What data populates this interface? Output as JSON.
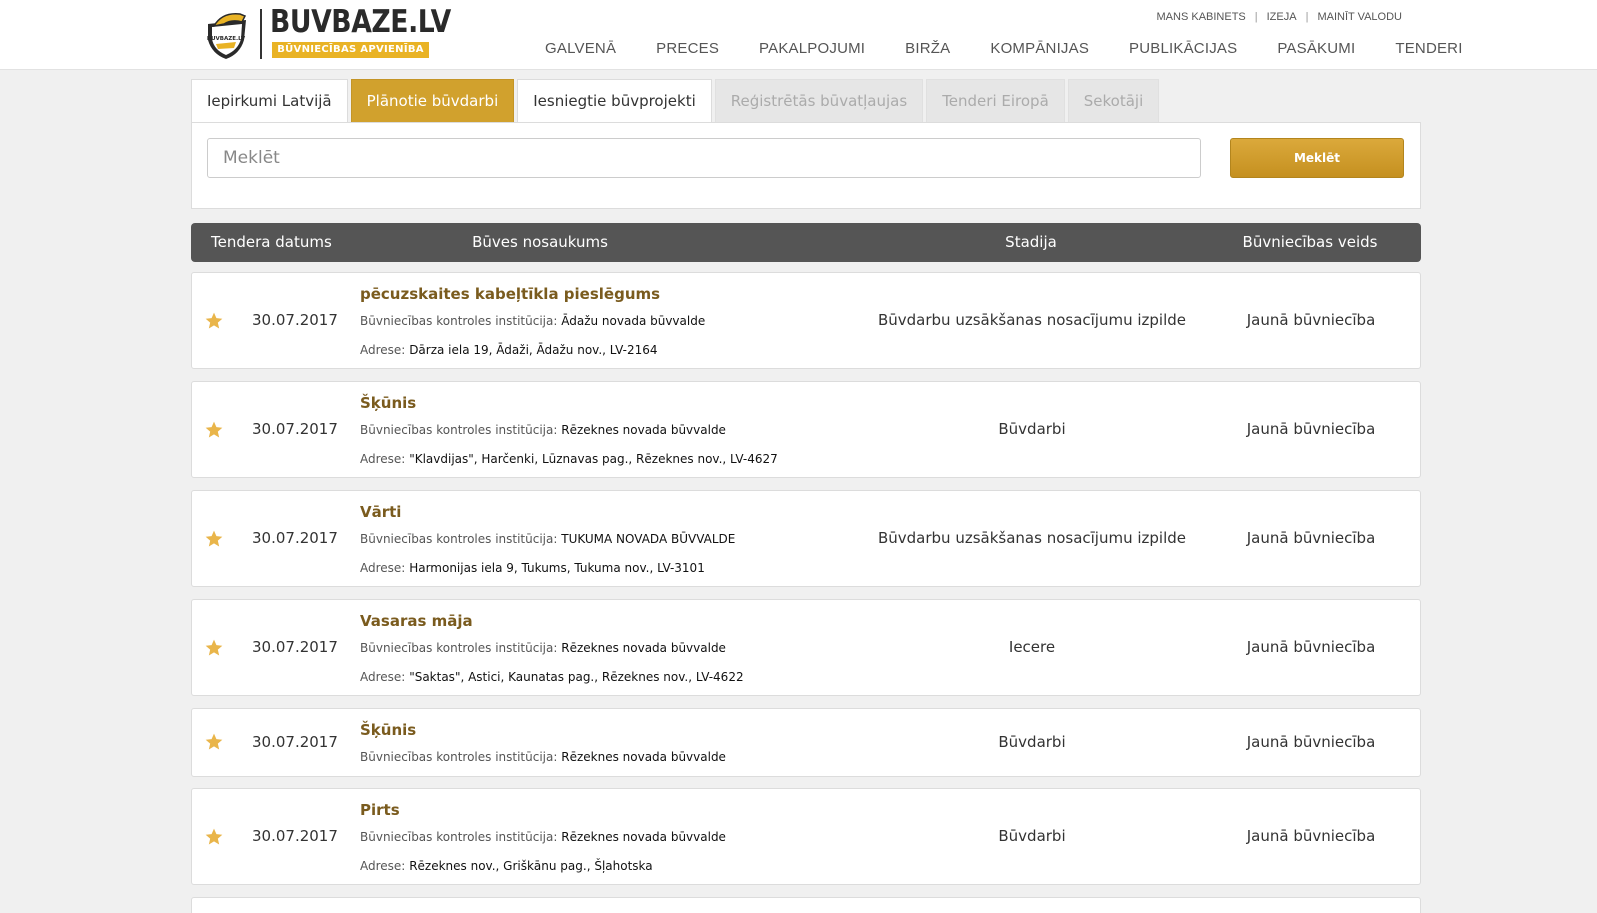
{
  "brand": {
    "name": "BUVBAZE.LV",
    "tagline": "BŪVNIECĪBAS APVIENĪBA",
    "emblem_text": "BUVBAZE.LV",
    "colors": {
      "gold": "#e9b325",
      "accent": "#d1a12d",
      "title": "#7a5b1e",
      "header_bar": "#555555"
    }
  },
  "toplinks": [
    "MANS KABINETS",
    "IZEJA",
    "MAINĪT VALODU"
  ],
  "nav": [
    "GALVENĀ",
    "PRECES",
    "PAKALPOJUMI",
    "BIRŽA",
    "KOMPĀNIJAS",
    "PUBLIKĀCIJAS",
    "PASĀKUMI",
    "TENDERI"
  ],
  "tabs": [
    {
      "label": "Iepirkumi Latvijā",
      "state": "normal"
    },
    {
      "label": "Plānotie būvdarbi",
      "state": "active"
    },
    {
      "label": "Iesniegtie būvprojekti",
      "state": "normal"
    },
    {
      "label": "Reģistrētās būvatļaujas",
      "state": "disabled"
    },
    {
      "label": "Tenderi Eiropā",
      "state": "disabled"
    },
    {
      "label": "Sekotāji",
      "state": "disabled"
    }
  ],
  "search": {
    "placeholder": "Meklēt",
    "button_label": "Meklēt"
  },
  "table": {
    "headers": {
      "date": "Tendera datums",
      "name": "Būves nosaukums",
      "stage": "Stadija",
      "type": "Būvniecības veids"
    },
    "inst_label": "Būvniecības kontroles institūcija:",
    "addr_label": "Adrese:",
    "rows": [
      {
        "date": "30.07.2017",
        "title": "pēcuzskaites kabeļtīkla pieslēgums",
        "institution": "Ādažu novada būvvalde",
        "address": "Dārza iela 19, Ādaži, Ādažu nov., LV-2164",
        "stage": "Būvdarbu uzsākšanas nosacījumu izpilde",
        "type": "Jaunā būvniecība"
      },
      {
        "date": "30.07.2017",
        "title": "Šķūnis",
        "institution": "Rēzeknes novada būvvalde",
        "address": "\"Klavdijas\", Harčenki, Lūznavas pag., Rēzeknes nov., LV-4627",
        "stage": "Būvdarbi",
        "type": "Jaunā būvniecība"
      },
      {
        "date": "30.07.2017",
        "title": "Vārti",
        "institution": "TUKUMA NOVADA BŪVVALDE",
        "address": "Harmonijas iela 9, Tukums, Tukuma nov., LV-3101",
        "stage": "Būvdarbu uzsākšanas nosacījumu izpilde",
        "type": "Jaunā būvniecība"
      },
      {
        "date": "30.07.2017",
        "title": "Vasaras māja",
        "institution": "Rēzeknes novada būvvalde",
        "address": "\"Saktas\", Astici, Kaunatas pag., Rēzeknes nov., LV-4622",
        "stage": "Iecere",
        "type": "Jaunā būvniecība"
      },
      {
        "date": "30.07.2017",
        "title": "Šķūnis",
        "institution": "Rēzeknes novada būvvalde",
        "stage": "Būvdarbi",
        "type": "Jaunā būvniecība"
      },
      {
        "date": "30.07.2017",
        "title": "Pirts",
        "institution": "Rēzeknes novada būvvalde",
        "address": "Rēzeknes nov., Griškānu pag., Šļahotska",
        "stage": "Būvdarbi",
        "type": "Jaunā būvniecība"
      }
    ]
  }
}
